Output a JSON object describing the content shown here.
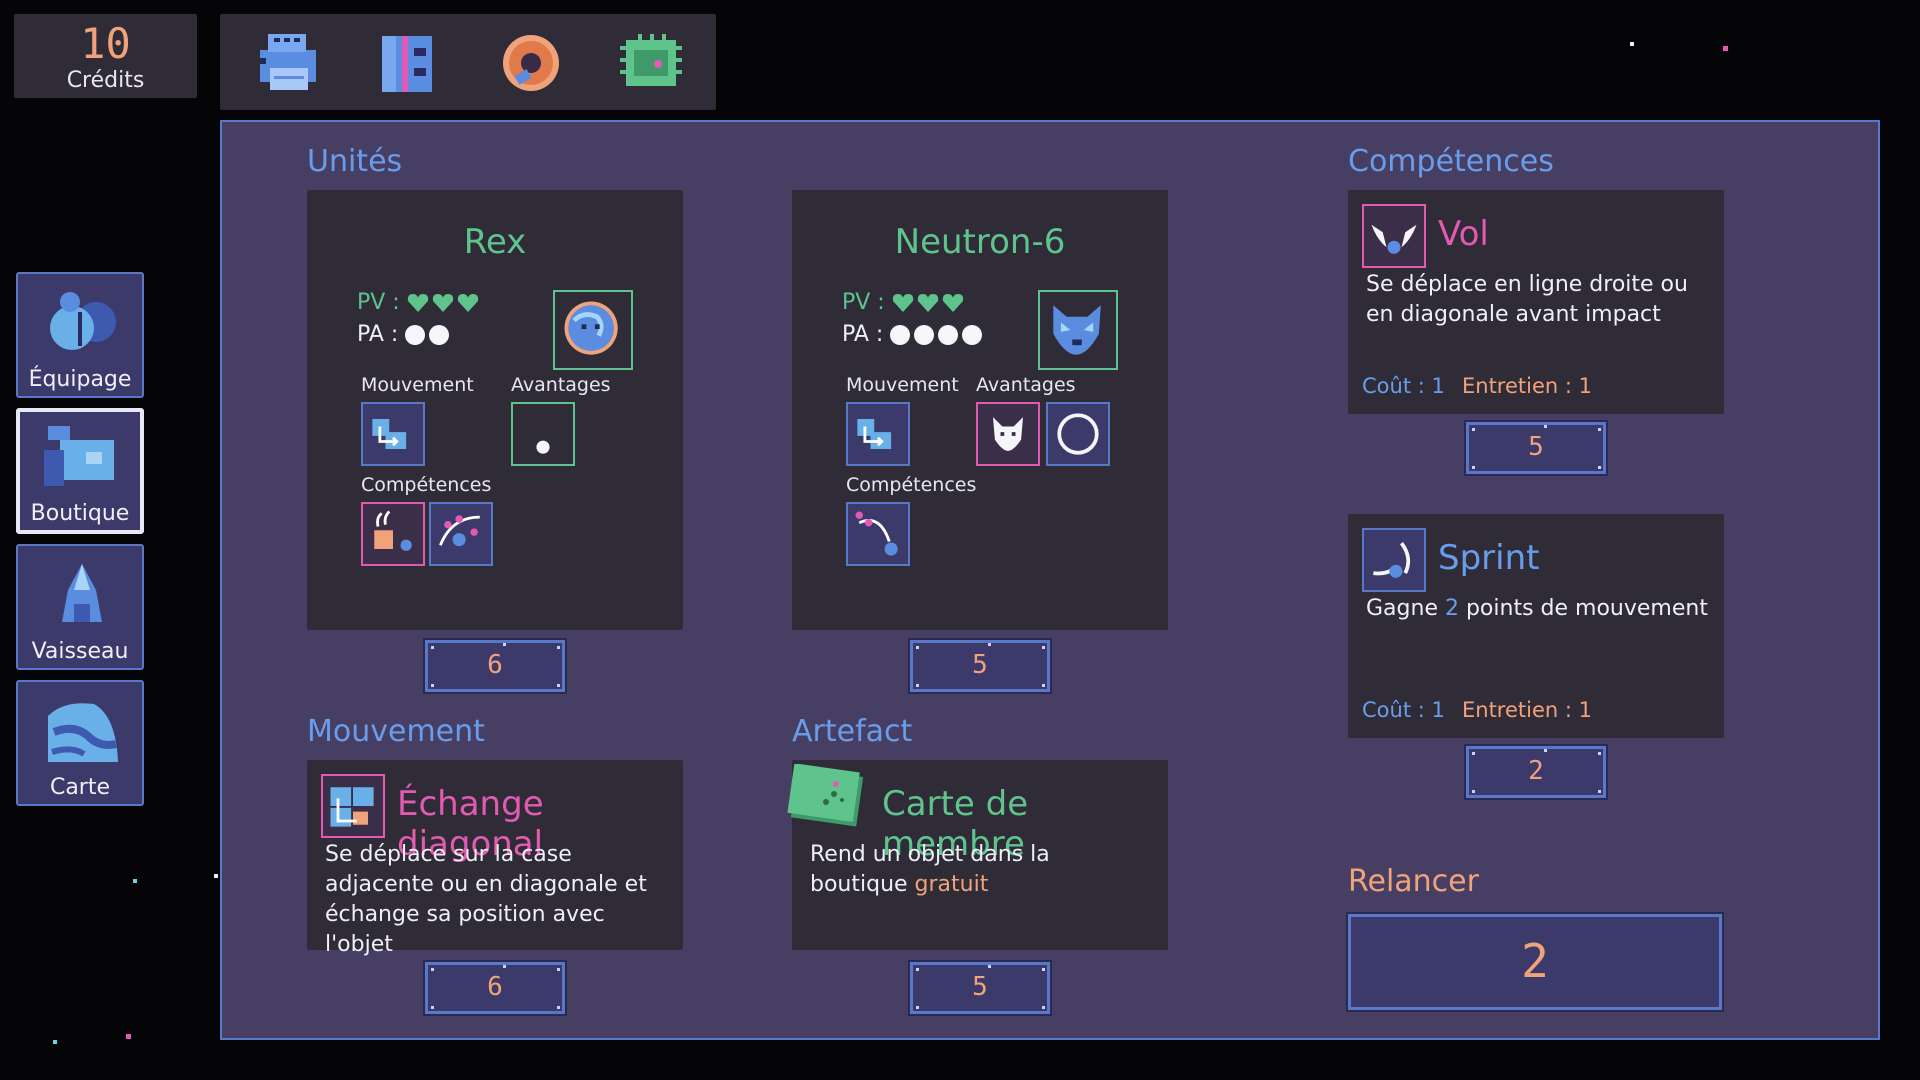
{
  "credits": {
    "value": "10",
    "label": "Crédits"
  },
  "topbar": {
    "icons": [
      "printer-icon",
      "cabinet-icon",
      "donut-icon",
      "chip-icon"
    ]
  },
  "nav": [
    {
      "label": "Équipage",
      "icon": "crew-icon",
      "active": false
    },
    {
      "label": "Boutique",
      "icon": "shop-icon",
      "active": true
    },
    {
      "label": "Vaisseau",
      "icon": "ship-icon",
      "active": false
    },
    {
      "label": "Carte",
      "icon": "map-icon",
      "active": false
    }
  ],
  "sections": {
    "units": "Unités",
    "skills": "Compétences",
    "movement": "Mouvement",
    "artifact": "Artefact",
    "reroll": "Relancer"
  },
  "units": [
    {
      "name": "Rex",
      "pv_label": "PV :",
      "pv": 3,
      "pa_label": "PA :",
      "pa": 2,
      "movement_label": "Mouvement",
      "perks_label": "Avantages",
      "skills_label": "Compétences",
      "price": "6"
    },
    {
      "name": "Neutron-6",
      "pv_label": "PV :",
      "pv": 3,
      "pa_label": "PA :",
      "pa": 4,
      "movement_label": "Mouvement",
      "perks_label": "Avantages",
      "skills_label": "Compétences",
      "price": "5"
    }
  ],
  "skills": [
    {
      "title": "Vol",
      "title_color": "#e25ab2",
      "desc": "Se déplace en ligne droite ou en diagonale avant impact",
      "cost_label": "Coût : 1",
      "upkeep_label": "Entretien : 1",
      "price": "5"
    },
    {
      "title": "Sprint",
      "title_color": "#6a9cec",
      "desc_pre": "Gagne ",
      "desc_num": "2",
      "desc_post": " points de mouvement",
      "cost_label": "Coût : 1",
      "upkeep_label": "Entretien : 1",
      "price": "2"
    }
  ],
  "movement": {
    "title": "Échange diagonal",
    "desc": "Se déplace sur la case adjacente ou en diagonale et échange sa position avec l'objet",
    "price": "6"
  },
  "artifact": {
    "title": "Carte de membre",
    "desc_pre": "Rend un objet dans la boutique ",
    "desc_highlight": "gratuit",
    "price": "5"
  },
  "reroll_price": "2",
  "colors": {
    "panel": "#463f63",
    "card": "#2f2c38",
    "accent_blue": "#6a9cec",
    "green": "#5ec48c",
    "pink": "#e25ab2",
    "orange": "#f0a27a"
  }
}
